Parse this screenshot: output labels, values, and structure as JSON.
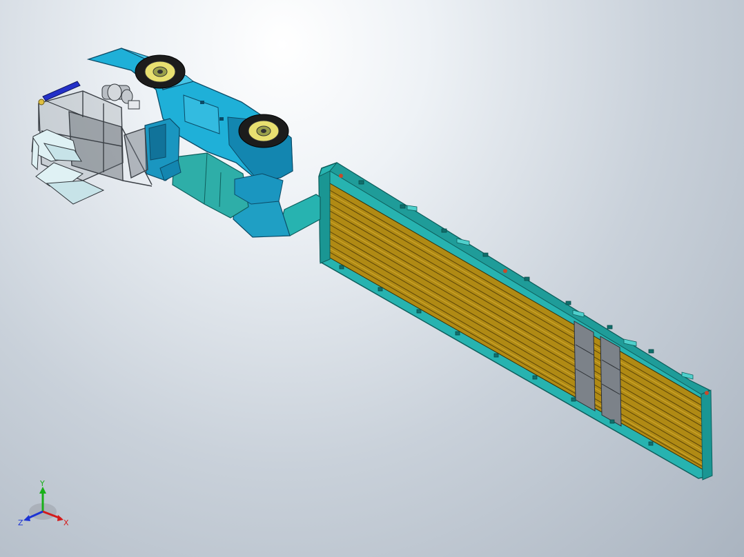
{
  "viewport": {
    "background_top": "#ffffff",
    "background_bottom": "#aab4c0"
  },
  "model": {
    "colors": {
      "body_cyan": "#1fb0d8",
      "body_cyan_dark": "#1386b0",
      "trailer_teal": "#27b3b0",
      "trailer_teal_dark": "#138c88",
      "deck_wood": "#b08a14",
      "deck_wood_light": "#d9ad24",
      "gray_frame": "#7c8289",
      "tire": "#1c1c1c",
      "rim_yellow": "#e8e070",
      "glass": "#dff1f4"
    }
  },
  "triad": {
    "x_label": "X",
    "y_label": "Y",
    "z_label": "Z",
    "x_color": "#d41a1a",
    "y_color": "#18b018",
    "z_color": "#1c34d4"
  }
}
